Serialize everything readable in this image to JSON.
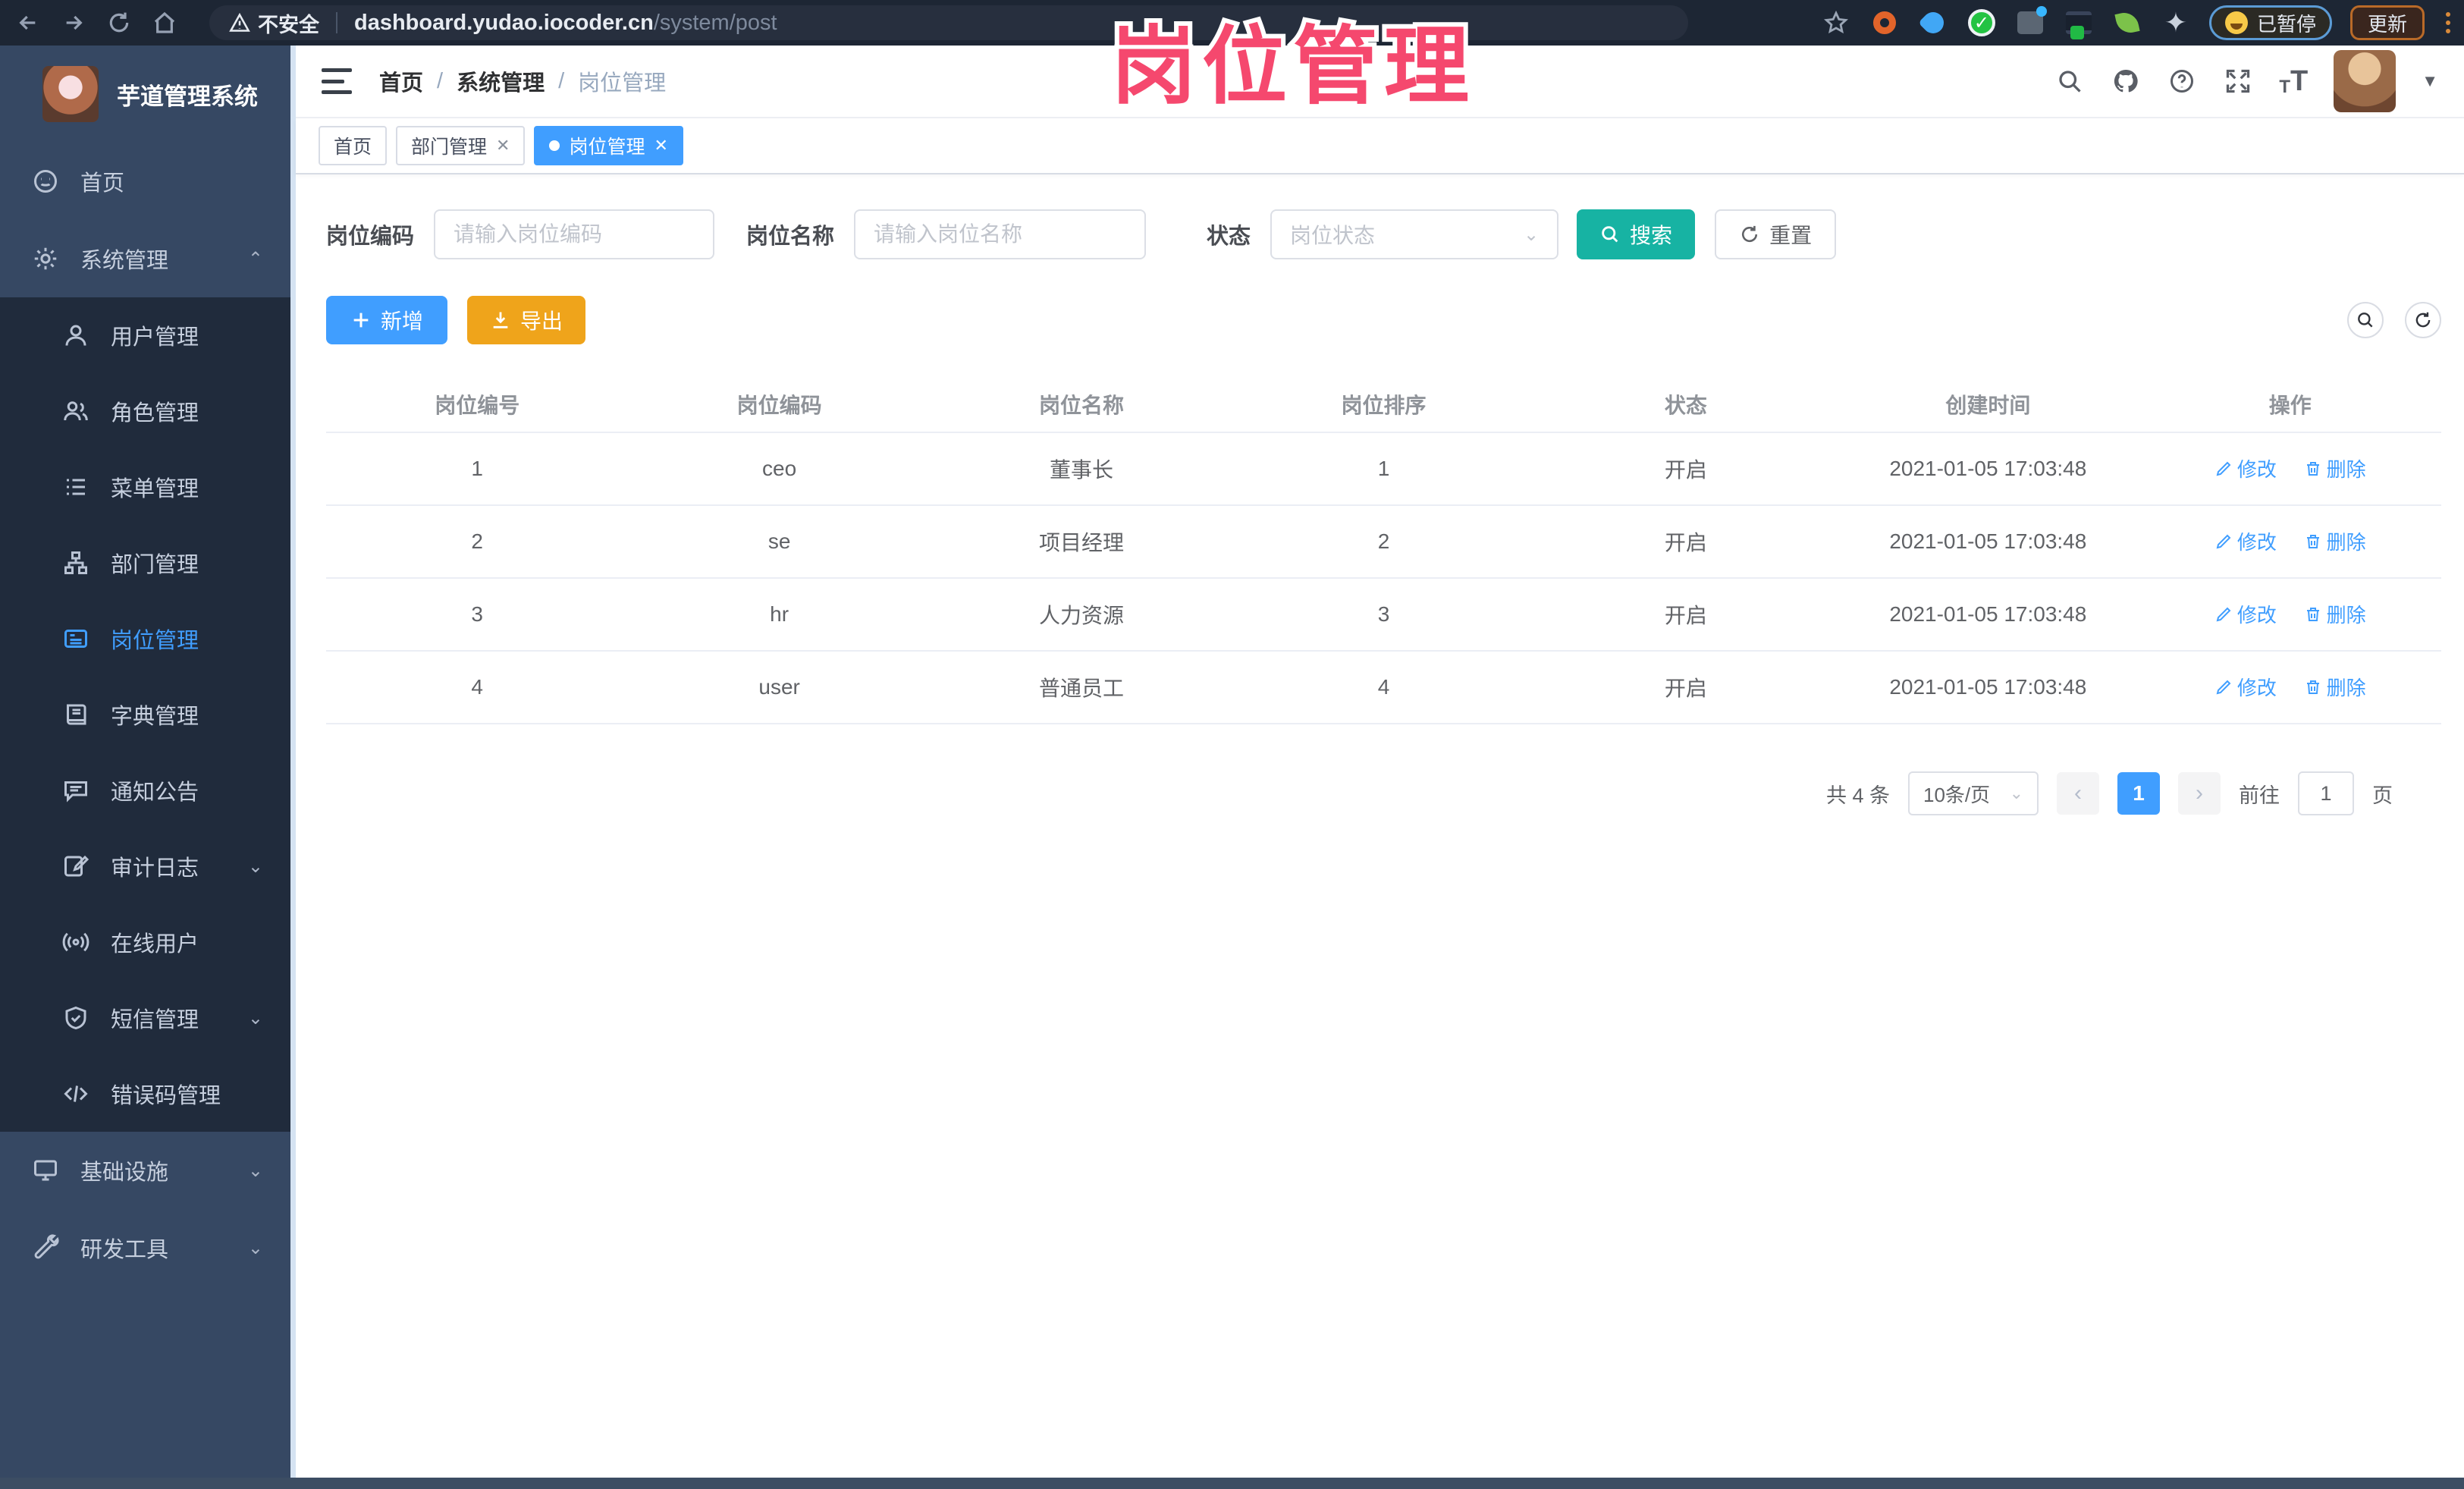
{
  "colors": {
    "primary": "#409eff",
    "search_button": "#17b3a3",
    "export_button": "#efa41b",
    "overlay_pink": "#f5486e",
    "sidebar_bg": "#364863",
    "submenu_bg": "#202b3c",
    "browser_bar_bg": "#1d2634"
  },
  "browser": {
    "security_label": "不安全",
    "url_host": "dashboard.yudao.iocoder.cn",
    "url_path": "/system/post",
    "paused_label": "已暂停",
    "update_label": "更新"
  },
  "overlay_title": "岗位管理",
  "sidebar": {
    "app_title": "芋道管理系统",
    "items": [
      {
        "label": "首页",
        "icon": "home-icon"
      },
      {
        "label": "系统管理",
        "icon": "gear-icon",
        "chevron": "up",
        "expanded": true
      },
      {
        "label": "用户管理",
        "icon": "user-icon"
      },
      {
        "label": "角色管理",
        "icon": "role-icon"
      },
      {
        "label": "菜单管理",
        "icon": "menu-list-icon"
      },
      {
        "label": "部门管理",
        "icon": "org-tree-icon"
      },
      {
        "label": "岗位管理",
        "icon": "post-badge-icon",
        "active": true
      },
      {
        "label": "字典管理",
        "icon": "dictionary-icon"
      },
      {
        "label": "通知公告",
        "icon": "announcement-icon"
      },
      {
        "label": "审计日志",
        "icon": "audit-log-icon",
        "chevron": "down"
      },
      {
        "label": "在线用户",
        "icon": "online-users-icon"
      },
      {
        "label": "短信管理",
        "icon": "sms-shield-icon",
        "chevron": "down"
      },
      {
        "label": "错误码管理",
        "icon": "error-code-icon"
      },
      {
        "label": "基础设施",
        "icon": "infrastructure-icon",
        "chevron": "down"
      },
      {
        "label": "研发工具",
        "icon": "dev-tools-icon",
        "chevron": "down"
      }
    ]
  },
  "header": {
    "breadcrumb": [
      "首页",
      "系统管理",
      "岗位管理"
    ],
    "separator": "/"
  },
  "tags": [
    {
      "label": "首页",
      "closable": false,
      "active": false
    },
    {
      "label": "部门管理",
      "closable": true,
      "active": false
    },
    {
      "label": "岗位管理",
      "closable": true,
      "active": true
    }
  ],
  "filters": {
    "code_label": "岗位编码",
    "code_placeholder": "请输入岗位编码",
    "name_label": "岗位名称",
    "name_placeholder": "请输入岗位名称",
    "status_label": "状态",
    "status_placeholder": "岗位状态",
    "search_label": "搜索",
    "reset_label": "重置"
  },
  "toolbar": {
    "add_label": "新增",
    "export_label": "导出"
  },
  "table": {
    "columns": [
      "岗位编号",
      "岗位编码",
      "岗位名称",
      "岗位排序",
      "状态",
      "创建时间",
      "操作"
    ],
    "rows": [
      {
        "id": "1",
        "code": "ceo",
        "name": "董事长",
        "sort": "1",
        "status": "开启",
        "created": "2021-01-05 17:03:48"
      },
      {
        "id": "2",
        "code": "se",
        "name": "项目经理",
        "sort": "2",
        "status": "开启",
        "created": "2021-01-05 17:03:48"
      },
      {
        "id": "3",
        "code": "hr",
        "name": "人力资源",
        "sort": "3",
        "status": "开启",
        "created": "2021-01-05 17:03:48"
      },
      {
        "id": "4",
        "code": "user",
        "name": "普通员工",
        "sort": "4",
        "status": "开启",
        "created": "2021-01-05 17:03:48"
      }
    ],
    "edit_label": "修改",
    "delete_label": "删除"
  },
  "pagination": {
    "total": "共 4 条",
    "page_size": "10条/页",
    "prev": "‹",
    "page": "1",
    "next": "›",
    "goto_label": "前往",
    "goto_value": "1",
    "unit_label": "页"
  }
}
